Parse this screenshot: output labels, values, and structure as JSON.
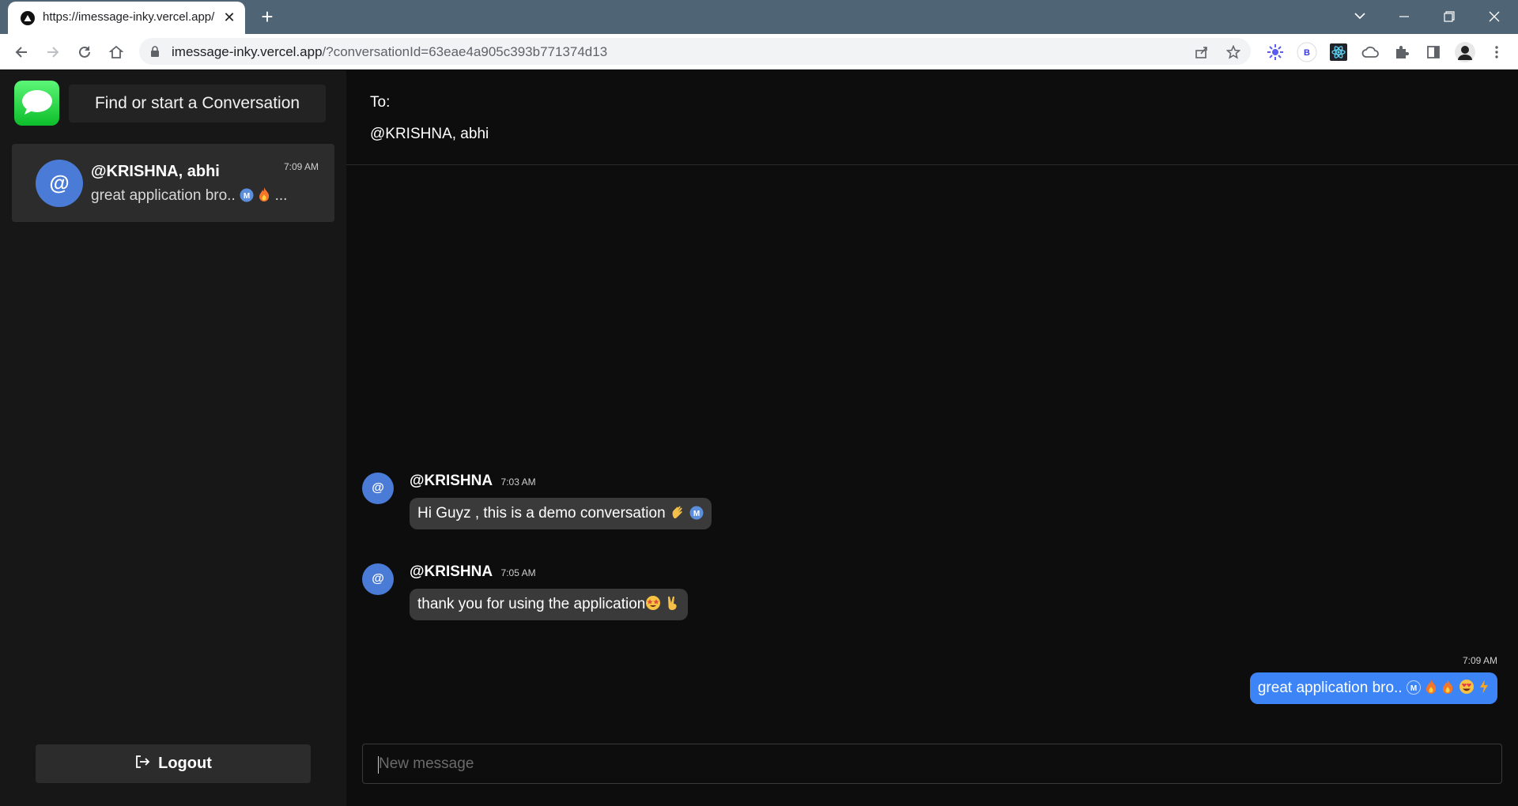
{
  "browser": {
    "tab_title": "https://imessage-inky.vercel.app/",
    "url_host": "imessage-inky.vercel.app",
    "url_path": "/?conversationId=63eae4a905c393b771374d13"
  },
  "sidebar": {
    "search_label": "Find or start a Conversation",
    "conversations": [
      {
        "avatar_text": "@",
        "name": "@KRISHNA, abhi",
        "time": "7:09 AM",
        "preview": "great application bro..",
        "preview_suffix": "..."
      }
    ],
    "logout_label": "Logout"
  },
  "chat": {
    "to_label": "To:",
    "recipients": "@KRISHNA, abhi",
    "messages": [
      {
        "avatar_text": "@",
        "sender": "@KRISHNA",
        "time": "7:03 AM",
        "text": "Hi Guyz , this is a demo conversation"
      },
      {
        "avatar_text": "@",
        "sender": "@KRISHNA",
        "time": "7:05 AM",
        "text": "thank you for using the application"
      }
    ],
    "own_message": {
      "time": "7:09 AM",
      "text": "great application bro.."
    },
    "input_placeholder": "New message"
  },
  "colors": {
    "accent_blue": "#3d84f7",
    "avatar_blue": "#4a7bd6",
    "app_green": "#28d146"
  }
}
